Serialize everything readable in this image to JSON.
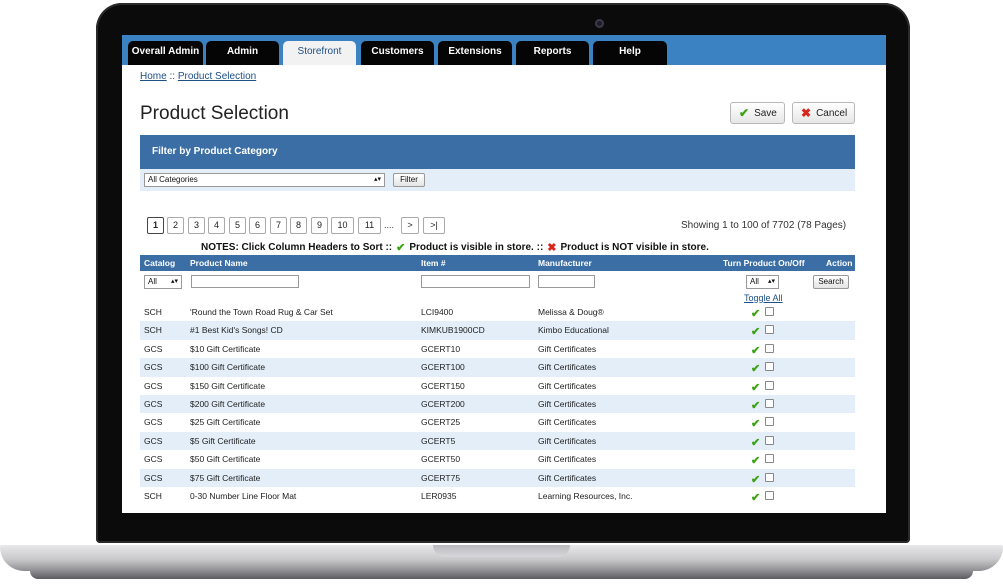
{
  "nav": {
    "tabs": [
      {
        "label": "Overall Admin"
      },
      {
        "label": "Admin"
      },
      {
        "label": "Storefront"
      },
      {
        "label": "Customers"
      },
      {
        "label": "Extensions"
      },
      {
        "label": "Reports"
      },
      {
        "label": "Help"
      }
    ],
    "active": "Storefront"
  },
  "breadcrumb": {
    "home": "Home",
    "sep": "::",
    "current": "Product Selection"
  },
  "page": {
    "title": "Product Selection",
    "save_label": "Save",
    "cancel_label": "Cancel"
  },
  "filter": {
    "title": "Filter by Product Category",
    "category_value": "All Categories",
    "button_label": "Filter"
  },
  "pagination": {
    "pages": [
      "1",
      "2",
      "3",
      "4",
      "5",
      "6",
      "7",
      "8",
      "9",
      "10",
      "11"
    ],
    "ellipsis": "....",
    "next": ">",
    "last": ">|",
    "showing": "Showing 1 to 100 of 7702 (78 Pages)"
  },
  "notes": {
    "prefix": "NOTES: Click Column Headers to Sort  ::",
    "visible": "Product is visible in store. ::",
    "not_visible": "Product is NOT visible in store."
  },
  "table": {
    "headers": {
      "catalog": "Catalog",
      "name": "Product Name",
      "item": "Item #",
      "manufacturer": "Manufacturer",
      "toggle": "Turn Product On/Off",
      "action": "Action"
    },
    "catalog_filter": "All",
    "toggle_filter": "All",
    "search_label": "Search",
    "toggle_all": "Toggle All",
    "rows": [
      {
        "catalog": "SCH",
        "name": "'Round the Town Road Rug & Car Set",
        "item": "LCI9400",
        "manufacturer": "Melissa & Doug®"
      },
      {
        "catalog": "SCH",
        "name": "#1 Best Kid's Songs! CD",
        "item": "KIMKUB1900CD",
        "manufacturer": "Kimbo Educational"
      },
      {
        "catalog": "GCS",
        "name": "$10 Gift Certificate",
        "item": "GCERT10",
        "manufacturer": "Gift Certificates"
      },
      {
        "catalog": "GCS",
        "name": "$100 Gift Certificate",
        "item": "GCERT100",
        "manufacturer": "Gift Certificates"
      },
      {
        "catalog": "GCS",
        "name": "$150 Gift Certificate",
        "item": "GCERT150",
        "manufacturer": "Gift Certificates"
      },
      {
        "catalog": "GCS",
        "name": "$200 Gift Certificate",
        "item": "GCERT200",
        "manufacturer": "Gift Certificates"
      },
      {
        "catalog": "GCS",
        "name": "$25 Gift Certificate",
        "item": "GCERT25",
        "manufacturer": "Gift Certificates"
      },
      {
        "catalog": "GCS",
        "name": "$5 Gift Certificate",
        "item": "GCERT5",
        "manufacturer": "Gift Certificates"
      },
      {
        "catalog": "GCS",
        "name": "$50 Gift Certificate",
        "item": "GCERT50",
        "manufacturer": "Gift Certificates"
      },
      {
        "catalog": "GCS",
        "name": "$75 Gift Certificate",
        "item": "GCERT75",
        "manufacturer": "Gift Certificates"
      },
      {
        "catalog": "SCH",
        "name": "0-30 Number Line Floor Mat",
        "item": "LER0935",
        "manufacturer": "Learning Resources, Inc."
      }
    ]
  },
  "colors": {
    "nav_blue": "#3b82c2",
    "header_blue": "#3b6ea5",
    "row_alt": "#e3eef8",
    "check_green": "#3aa312",
    "cross_red": "#d9261c"
  }
}
